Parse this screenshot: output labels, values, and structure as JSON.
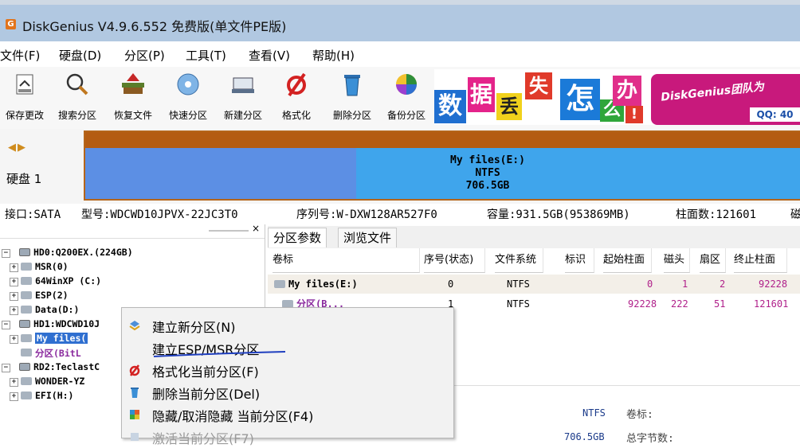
{
  "window": {
    "title": "DiskGenius V4.9.6.552 免费版(单文件PE版)",
    "app_icon_letter": "G"
  },
  "menu": [
    "文件(F)",
    "硬盘(D)",
    "分区(P)",
    "工具(T)",
    "查看(V)",
    "帮助(H)"
  ],
  "toolbar": [
    "保存更改",
    "搜索分区",
    "恢复文件",
    "快速分区",
    "新建分区",
    "格式化",
    "删除分区",
    "备份分区"
  ],
  "banner": {
    "chars": [
      "数",
      "据",
      "丢",
      "失",
      "怎",
      "么",
      "办",
      "!"
    ],
    "brand": "DiskGenius团队为",
    "qq": "QQ: 40"
  },
  "disk_panel": {
    "label": "硬盘 1",
    "partition_name": "My files(E:)",
    "partition_fs": "NTFS",
    "partition_size": "706.5GB"
  },
  "disk_info": {
    "interface": "接口:SATA",
    "model": "型号:WDCWD10JPVX-22JC3T0",
    "serial": "序列号:W-DXW128AR527F0",
    "capacity": "容量:931.5GB(953869MB)",
    "cylinders": "柱面数:121601",
    "more": "磁"
  },
  "tree": {
    "close": "×",
    "rows": [
      {
        "label": "HD0:Q200EX.(224GB)",
        "exp": "−",
        "level": 0
      },
      {
        "label": "MSR(0)",
        "exp": "+",
        "level": 1
      },
      {
        "label": "64WinXP (C:)",
        "exp": "+",
        "level": 1
      },
      {
        "label": "ESP(2)",
        "exp": "+",
        "level": 1
      },
      {
        "label": "Data(D:)",
        "exp": "+",
        "level": 1
      },
      {
        "label": "HD1:WDCWD10J",
        "exp": "−",
        "level": 0
      },
      {
        "label": "My files(",
        "exp": "+",
        "level": 1
      },
      {
        "label": "分区(BitL",
        "exp": "",
        "level": 1
      },
      {
        "label": "RD2:TeclastC",
        "exp": "−",
        "level": 0
      },
      {
        "label": "WONDER-YZ",
        "exp": "+",
        "level": 1
      },
      {
        "label": "EFI(H:)",
        "exp": "+",
        "level": 1
      }
    ]
  },
  "tabs": [
    "分区参数",
    "浏览文件"
  ],
  "table": {
    "headers": [
      "卷标",
      "序号(状态)",
      "文件系统",
      "标识",
      "起始柱面",
      "磁头",
      "扇区",
      "终止柱面"
    ],
    "rows": [
      {
        "label": "My files(E:)",
        "index": "0",
        "fs": "NTFS",
        "id": "",
        "start": "0",
        "head": "1",
        "sector": "2",
        "end": "92228"
      },
      {
        "label": "分区(B...",
        "index": "1",
        "fs": "NTFS",
        "id": "",
        "start": "92228",
        "head": "222",
        "sector": "51",
        "end": "121601"
      }
    ]
  },
  "details": {
    "fs": "NTFS",
    "label_caption": "卷标:",
    "size": "706.5GB",
    "total_bytes": "总字节数:"
  },
  "context_menu": [
    {
      "label": "建立新分区(N)",
      "icon": "new-partition-icon",
      "disabled": false
    },
    {
      "label": "建立ESP/MSR分区",
      "icon": "",
      "disabled": false
    },
    {
      "label": "格式化当前分区(F)",
      "icon": "format-icon",
      "disabled": false
    },
    {
      "label": "删除当前分区(Del)",
      "icon": "delete-icon",
      "disabled": false
    },
    {
      "label": "隐藏/取消隐藏 当前分区(F4)",
      "icon": "hide-icon",
      "disabled": false
    },
    {
      "label": "激活当前分区(F7)",
      "icon": "activate-icon",
      "disabled": true
    }
  ],
  "colors": {
    "titlebar": "#b1c8e1",
    "partition_header": "#b45c12",
    "partition_fill": "#3fa5ec",
    "selection_row": "#f3efe8",
    "annotation_stroke": "#1f3fbf"
  }
}
